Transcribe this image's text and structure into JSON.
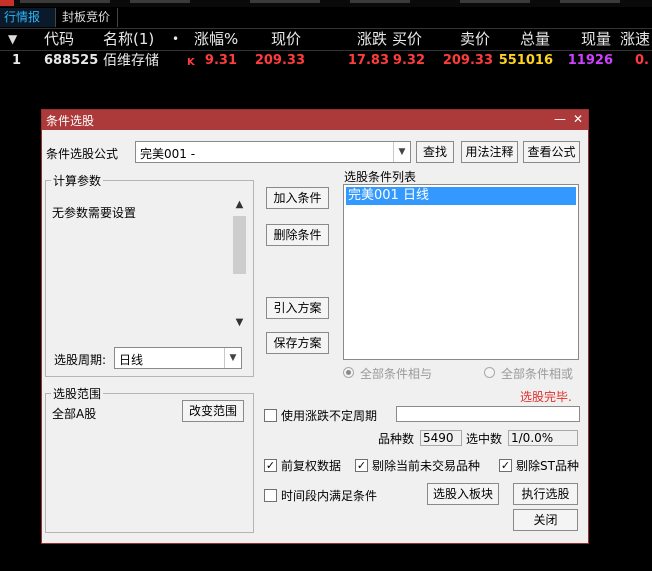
{
  "tabs": [
    "行情报价",
    "封板竞价"
  ],
  "table": {
    "headers": [
      "代码",
      "名称(1)",
      "•",
      "涨幅%",
      "现价",
      "涨跌",
      "买价",
      "卖价",
      "总量",
      "现量",
      "涨速"
    ],
    "row": {
      "index": "1",
      "code": "688525",
      "name": "佰维存储",
      "mark": "K",
      "change_pct": "9.31",
      "price": "209.33",
      "change": "17.83",
      "bid": "9.32",
      "ask": "209.33",
      "volume": "551016",
      "last_volume": "11926",
      "speed": "0.",
      "colors": {
        "red": "#ff3b3b",
        "yellow": "#ffd21f",
        "magenta": "#d040ff"
      }
    }
  },
  "dialog": {
    "title": "条件选股",
    "formula_label": "条件选股公式",
    "formula_value": "完美001  -",
    "btn_find": "查找",
    "btn_usage": "用法注释",
    "btn_view": "查看公式",
    "params_group": "计算参数",
    "params_text": "无参数需要设置",
    "period_label": "选股周期:",
    "period_value": "日线",
    "btn_add": "加入条件",
    "btn_delete": "删除条件",
    "btn_import": "引入方案",
    "btn_save": "保存方案",
    "list_title": "选股条件列表",
    "list_items": [
      "完美001  日线"
    ],
    "radio_and": "全部条件相与",
    "radio_or": "全部条件相或",
    "status": "选股完毕.",
    "range_group": "选股范围",
    "range_value": "全部A股",
    "btn_range": "改变范围",
    "chk_uncertain": "使用涨跌不定周期",
    "count_label": "品种数",
    "count_value": "5490",
    "selected_label": "选中数",
    "selected_value": "1/0.0%",
    "chk_restore": "前复权数据",
    "chk_notrade": "剔除当前未交易品种",
    "chk_st": "剔除ST品种",
    "chk_timerange": "时间段内满足条件",
    "btn_toblock": "选股入板块",
    "btn_run": "执行选股",
    "btn_close": "关闭",
    "check_glyph": "✓"
  }
}
